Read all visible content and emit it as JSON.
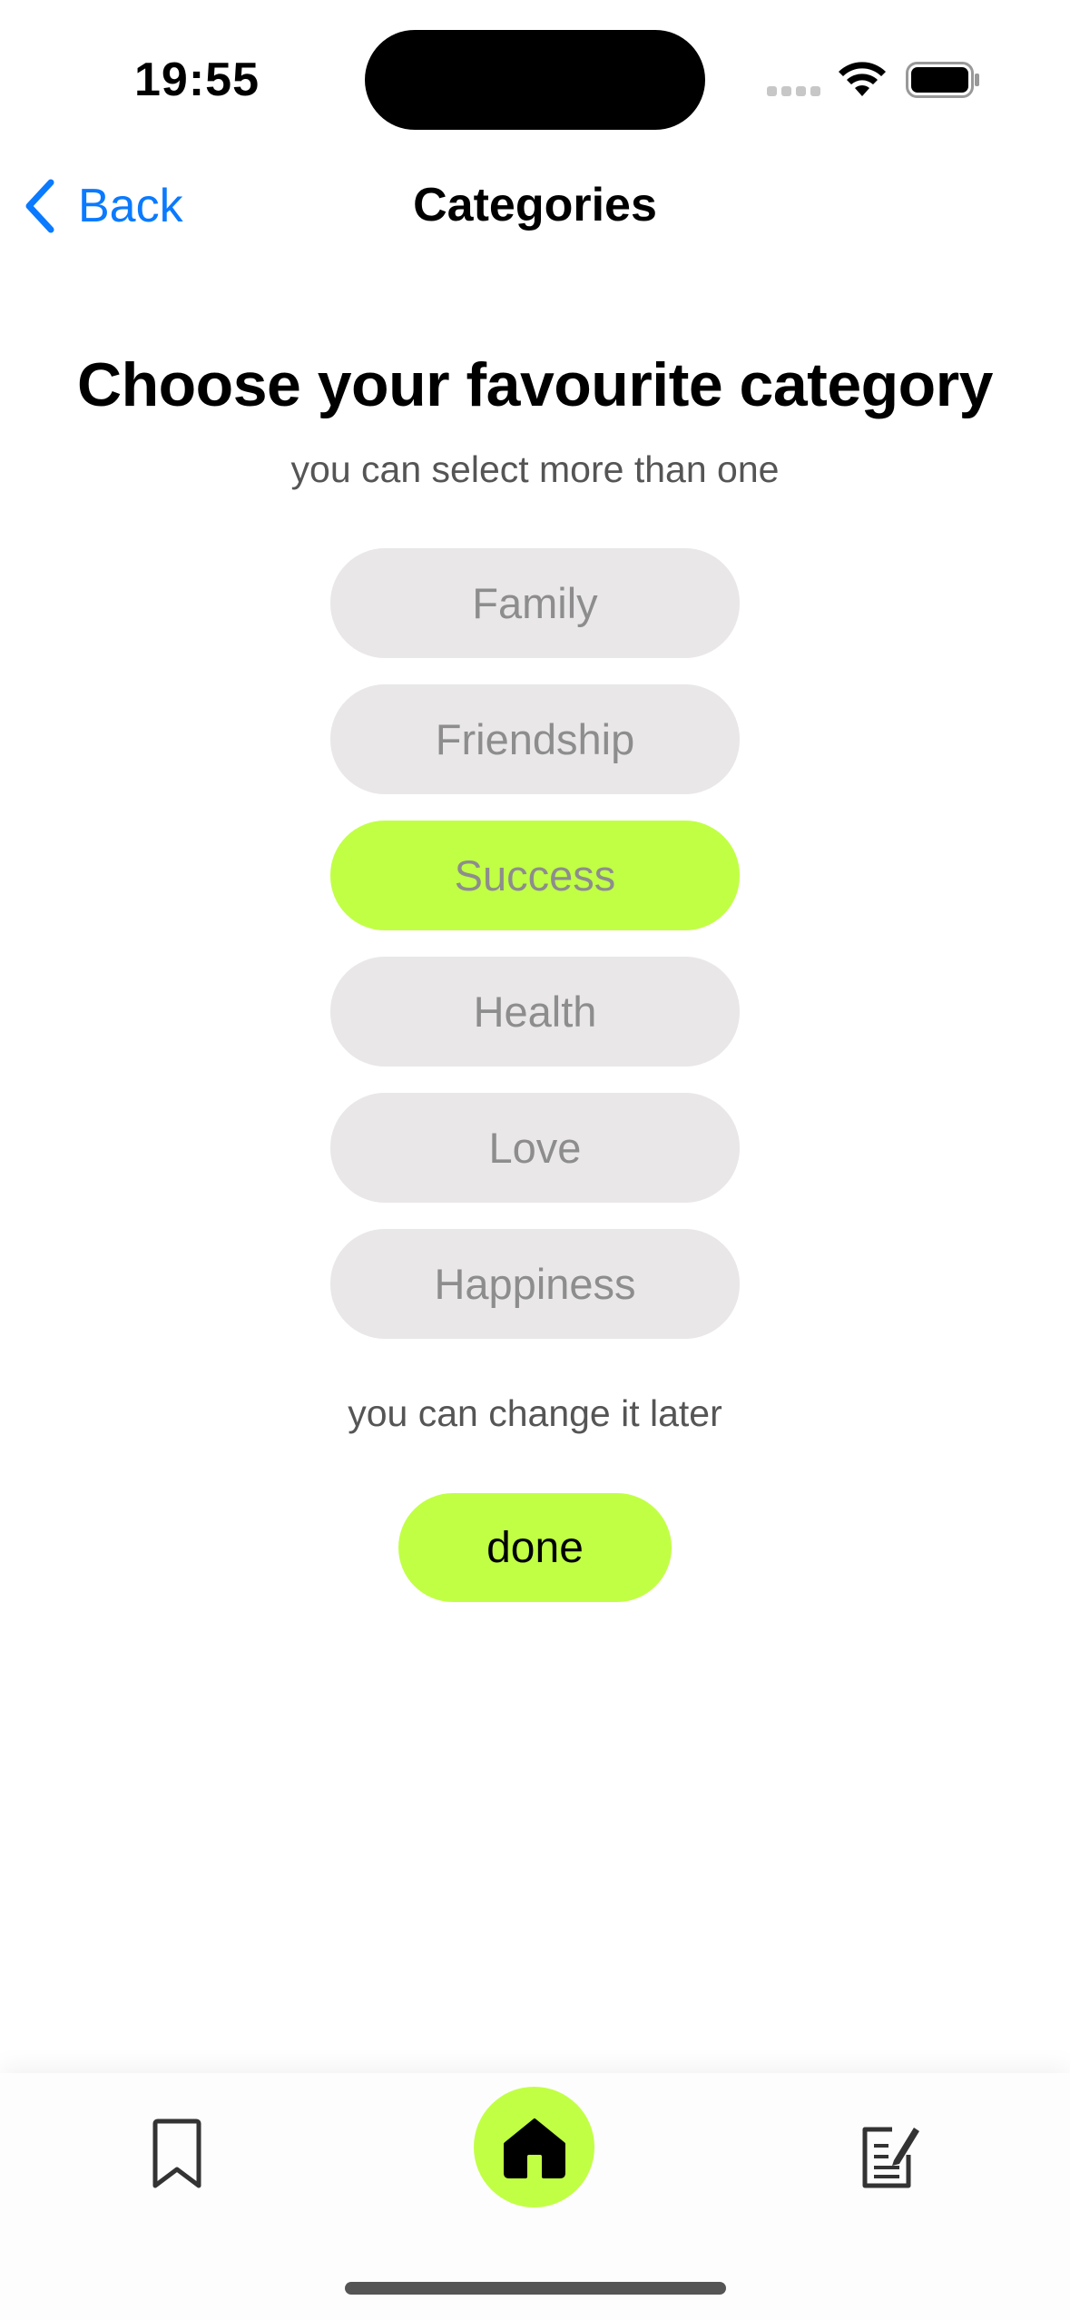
{
  "status_bar": {
    "time": "19:55"
  },
  "nav": {
    "back_label": "Back",
    "title": "Categories"
  },
  "page": {
    "title": "Choose your favourite category",
    "subtitle": "you can select more than one",
    "note": "you can change it later",
    "done_label": "done"
  },
  "categories": [
    {
      "label": "Family",
      "selected": false
    },
    {
      "label": "Friendship",
      "selected": false
    },
    {
      "label": "Success",
      "selected": true
    },
    {
      "label": "Health",
      "selected": false
    },
    {
      "label": "Love",
      "selected": false
    },
    {
      "label": "Happiness",
      "selected": false
    }
  ],
  "tabbar": {
    "items": [
      {
        "icon": "bookmark-icon",
        "active": false
      },
      {
        "icon": "home-icon",
        "active": true
      },
      {
        "icon": "notes-edit-icon",
        "active": false
      }
    ]
  },
  "colors": {
    "accent": "#c1ff45",
    "link": "#0a7aff",
    "pill": "#e9e7e8",
    "pill_text": "#8d8d8d"
  }
}
